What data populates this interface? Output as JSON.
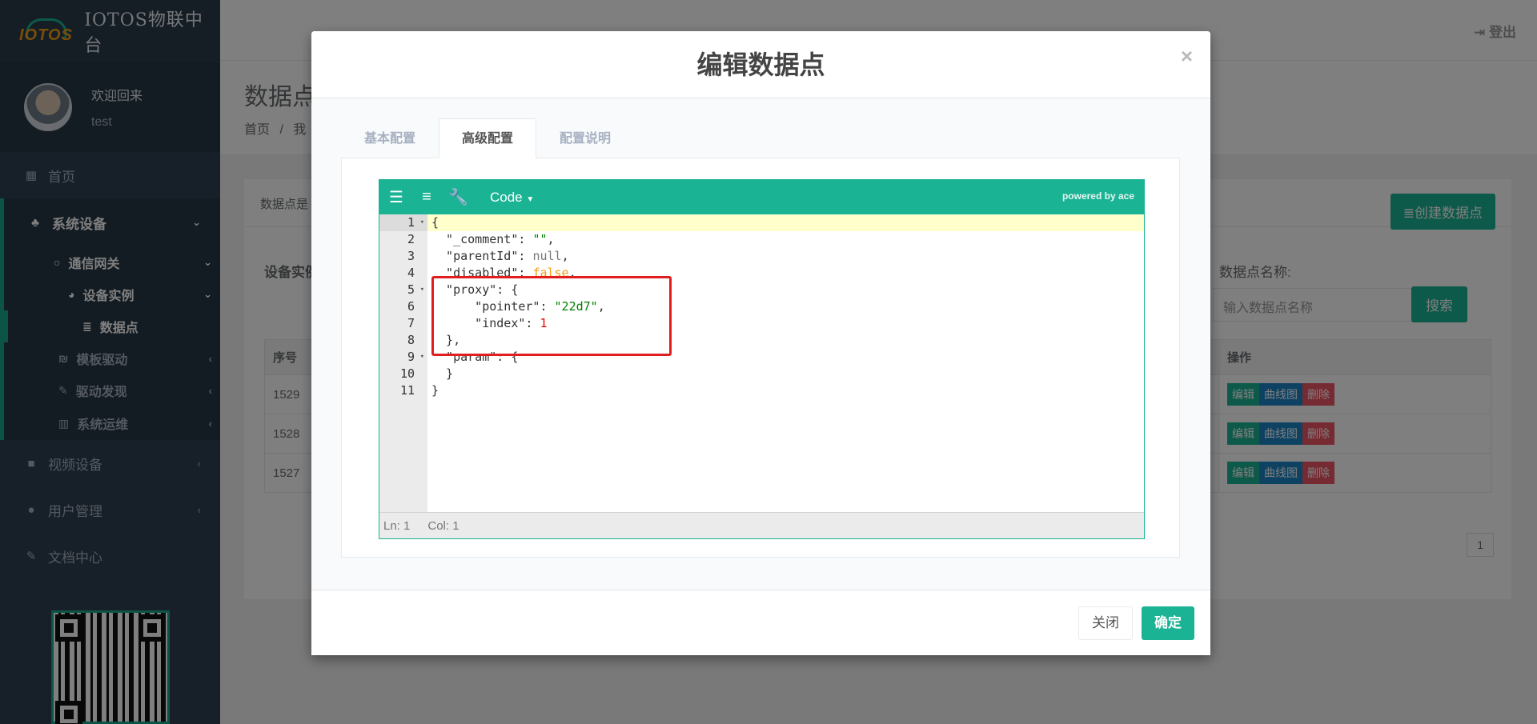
{
  "brand": {
    "logo_text": "IOTOS",
    "title": "IOTOS物联中台"
  },
  "profile": {
    "welcome": "欢迎回来",
    "username": "test"
  },
  "sidebar": {
    "home": "首页",
    "system_devices": "系统设备",
    "gateway": "通信网关",
    "device_instance": "设备实例",
    "data_point": "数据点",
    "template_driver": "模板驱动",
    "driver_discovery": "驱动发现",
    "system_ops": "系统运维",
    "video_devices": "视频设备",
    "user_mgmt": "用户管理",
    "docs": "文档中心"
  },
  "topbar": {
    "logout": "登出"
  },
  "page": {
    "title": "数据点",
    "breadcrumb_home": "首页",
    "breadcrumb_sep": "/",
    "breadcrumb_next": "我",
    "panel_text": "数据点是",
    "create_button": "创建数据点",
    "filter_label": "设备实例",
    "name_label": "数据点名称:",
    "name_placeholder": "输入数据点名称",
    "search_button": "搜索",
    "col_id": "序号",
    "col_actions": "操作",
    "rows": [
      {
        "id": "1529"
      },
      {
        "id": "1528"
      },
      {
        "id": "1527"
      }
    ],
    "btn_edit": "编辑",
    "btn_curve": "曲线图",
    "btn_delete": "删除",
    "page_number": "1"
  },
  "modal": {
    "title": "编辑数据点",
    "close": "×",
    "tabs": [
      "基本配置",
      "高级配置",
      "配置说明"
    ],
    "editor": {
      "mode": "Code",
      "powered_by": "powered by ace",
      "status_ln": "Ln: 1",
      "status_col": "Col: 1",
      "line_numbers": [
        "1",
        "2",
        "3",
        "4",
        "5",
        "6",
        "7",
        "8",
        "9",
        "10",
        "11"
      ],
      "lines": [
        "{",
        "  \"_comment\": \"\",",
        "  \"parentId\": null,",
        "  \"disabled\": false,",
        "  \"proxy\": {",
        "      \"pointer\": \"22d7\",",
        "      \"index\": 1",
        "  },",
        "  \"param\": {",
        "  }",
        "}"
      ]
    },
    "footer": {
      "close_button": "关闭",
      "ok_button": "确定"
    }
  },
  "colors": {
    "primary": "#1ab394",
    "sidebar": "#2f4050",
    "danger": "#ed5565",
    "info": "#1c84c6",
    "annotation": "#e01e1e"
  }
}
